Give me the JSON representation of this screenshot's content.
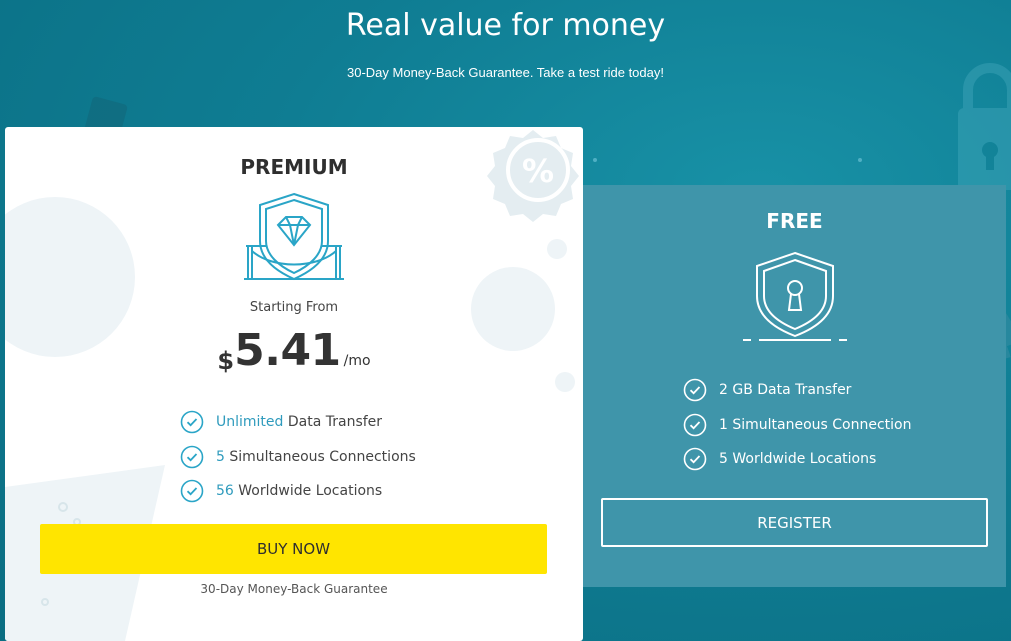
{
  "header": {
    "title": "Real value for money",
    "subtitle": "30-Day Money-Back Guarantee. Take a test ride today!"
  },
  "premium": {
    "name": "PREMIUM",
    "icon": "diamond-shield-icon",
    "starting_from": "Starting From",
    "price_currency": "$",
    "price_amount": "5.41",
    "price_period": "/mo",
    "features": [
      {
        "highlight": "Unlimited",
        "text": " Data Transfer"
      },
      {
        "highlight": "5",
        "text": " Simultaneous Connections"
      },
      {
        "highlight": "56",
        "text": " Worldwide Locations"
      }
    ],
    "button_label": "BUY NOW",
    "guarantee_note": "30-Day Money-Back Guarantee"
  },
  "free": {
    "name": "FREE",
    "icon": "keyhole-shield-icon",
    "features": [
      {
        "text": "2 GB Data Transfer"
      },
      {
        "text": "1 Simultaneous Connection"
      },
      {
        "text": "5 Worldwide Locations"
      }
    ],
    "button_label": "REGISTER"
  },
  "colors": {
    "background": "#0f7d93",
    "accent": "#2f9bbd",
    "buy_button": "#ffe500",
    "free_card": "#3f95aa"
  }
}
